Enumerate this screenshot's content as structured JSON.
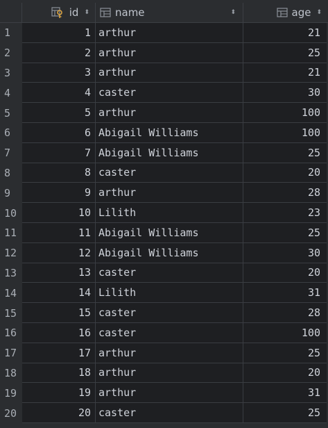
{
  "columns": {
    "id": "id",
    "name": "name",
    "age": "age"
  },
  "sort_glyph": "⬍",
  "rows": [
    {
      "n": "1",
      "id": "1",
      "name": "arthur",
      "age": "21"
    },
    {
      "n": "2",
      "id": "2",
      "name": "arthur",
      "age": "25"
    },
    {
      "n": "3",
      "id": "3",
      "name": "arthur",
      "age": "21"
    },
    {
      "n": "4",
      "id": "4",
      "name": "caster",
      "age": "30"
    },
    {
      "n": "5",
      "id": "5",
      "name": "arthur",
      "age": "100"
    },
    {
      "n": "6",
      "id": "6",
      "name": "Abigail Williams",
      "age": "100"
    },
    {
      "n": "7",
      "id": "7",
      "name": "Abigail Williams",
      "age": "25"
    },
    {
      "n": "8",
      "id": "8",
      "name": "caster",
      "age": "20"
    },
    {
      "n": "9",
      "id": "9",
      "name": "arthur",
      "age": "28"
    },
    {
      "n": "10",
      "id": "10",
      "name": "Lilith",
      "age": "23"
    },
    {
      "n": "11",
      "id": "11",
      "name": "Abigail Williams",
      "age": "25"
    },
    {
      "n": "12",
      "id": "12",
      "name": "Abigail Williams",
      "age": "30"
    },
    {
      "n": "13",
      "id": "13",
      "name": "caster",
      "age": "20"
    },
    {
      "n": "14",
      "id": "14",
      "name": "Lilith",
      "age": "31"
    },
    {
      "n": "15",
      "id": "15",
      "name": "caster",
      "age": "28"
    },
    {
      "n": "16",
      "id": "16",
      "name": "caster",
      "age": "100"
    },
    {
      "n": "17",
      "id": "17",
      "name": "arthur",
      "age": "25"
    },
    {
      "n": "18",
      "id": "18",
      "name": "arthur",
      "age": "20"
    },
    {
      "n": "19",
      "id": "19",
      "name": "arthur",
      "age": "31"
    },
    {
      "n": "20",
      "id": "20",
      "name": "caster",
      "age": "25"
    }
  ],
  "icons": {
    "id": "primary-key-column-icon",
    "name": "table-column-icon",
    "age": "table-column-icon",
    "sort": "sort-arrows-icon"
  },
  "colors": {
    "background": "#2b2d30",
    "cell_background": "#1e1f22",
    "key_icon": "#d9a343",
    "text": "#cfd3da"
  }
}
